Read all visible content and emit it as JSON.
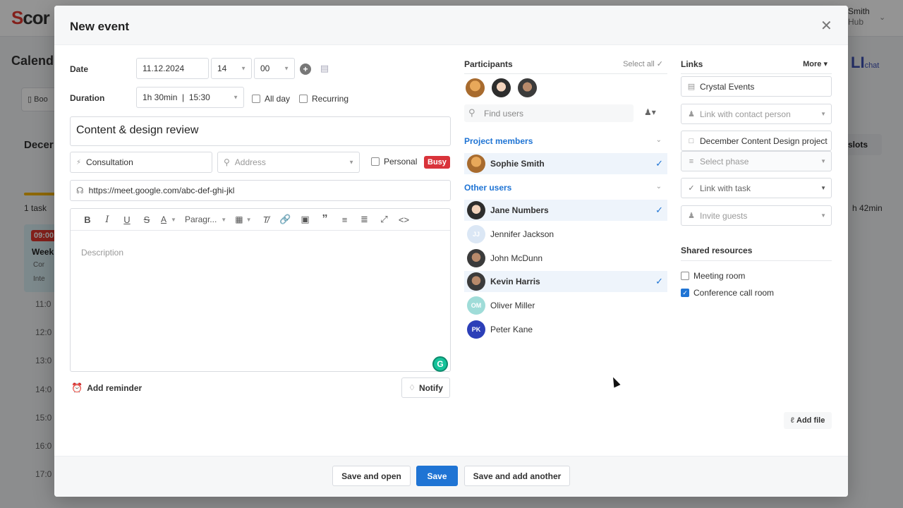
{
  "background": {
    "logo": "Scor",
    "user_name": "Smith",
    "user_sub": "Hub",
    "page_title": "Calend",
    "book_label": "Boo",
    "month_label": "Decer",
    "task_count": "1 task",
    "card_time": "09:00",
    "card_title": "Week",
    "card_line2": "Cor",
    "card_line3": "Inte",
    "hours": [
      "11:0",
      "12:0",
      "13:0",
      "14:0",
      "15:0",
      "16:0",
      "17:0"
    ],
    "right_logo": "LI",
    "right_logo_sub": "chat",
    "slots_label": "slots",
    "duration_right": "h 42min"
  },
  "modal": {
    "title": "New event",
    "close_icon": "close-icon"
  },
  "form": {
    "date_label": "Date",
    "date_value": "11.12.2024",
    "hour_value": "14",
    "minute_value": "00",
    "duration_label": "Duration",
    "duration_value": "1h 30min  |  15:30",
    "all_day_label": "All day",
    "recurring_label": "Recurring",
    "event_title": "Content & design review",
    "type_value": "Consultation",
    "address_placeholder": "Address",
    "personal_label": "Personal",
    "busy_label": "Busy",
    "meeting_link": "https://meet.google.com/abc-def-ghi-jkl",
    "paragraph_label": "Paragr...",
    "description_placeholder": "Description",
    "add_reminder_label": "Add reminder",
    "notify_label": "Notify"
  },
  "participants": {
    "header": "Participants",
    "select_all": "Select all",
    "find_placeholder": "Find users",
    "project_members_label": "Project members",
    "other_users_label": "Other users",
    "project_members": [
      {
        "name": "Sophie Smith",
        "selected": true
      }
    ],
    "other_users": [
      {
        "name": "Jane Numbers",
        "selected": true
      },
      {
        "name": "Jennifer Jackson",
        "initials": "JJ",
        "selected": false
      },
      {
        "name": "John McDunn",
        "selected": false
      },
      {
        "name": "Kevin Harris",
        "selected": true
      },
      {
        "name": "Oliver Miller",
        "initials": "OM",
        "selected": false
      },
      {
        "name": "Peter Kane",
        "initials": "PK",
        "selected": false
      }
    ]
  },
  "links": {
    "header": "Links",
    "more_label": "More",
    "company": "Crystal Events",
    "contact_placeholder": "Link with contact person",
    "project": "December Content Design project",
    "phase_placeholder": "Select phase",
    "task_placeholder": "Link with task",
    "guests_placeholder": "Invite guests",
    "shared_resources_label": "Shared resources",
    "meeting_room_label": "Meeting room",
    "conference_room_label": "Conference call room",
    "add_file_label": "Add file"
  },
  "footer": {
    "save_open": "Save and open",
    "save": "Save",
    "save_add": "Save and add another"
  },
  "colors": {
    "primary": "#1f74d4",
    "busy": "#d9333a",
    "selected_row": "#eef4fb"
  }
}
